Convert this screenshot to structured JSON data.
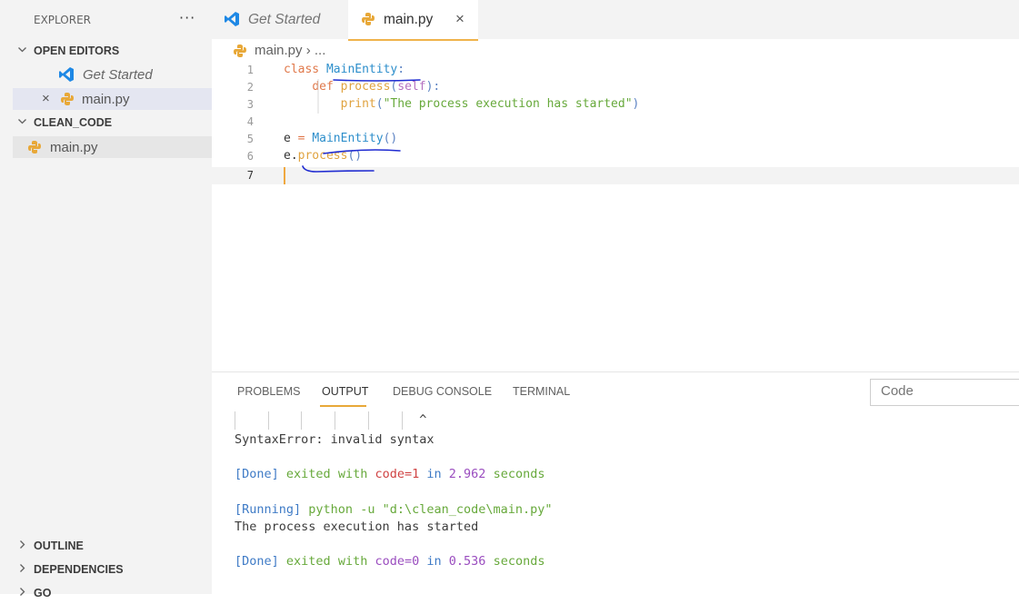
{
  "explorer": {
    "title": "EXPLORER",
    "more": "···",
    "open_editors": {
      "label": "OPEN EDITORS",
      "items": [
        {
          "label": "Get Started"
        },
        {
          "label": "main.py",
          "close": "×"
        }
      ]
    },
    "folder": {
      "label": "CLEAN_CODE",
      "items": [
        {
          "label": "main.py"
        }
      ]
    },
    "outline": "OUTLINE",
    "dependencies": "DEPENDENCIES",
    "go": "GO"
  },
  "tabs": [
    {
      "label": "Get Started"
    },
    {
      "label": "main.py",
      "close": "×"
    }
  ],
  "breadcrumb": {
    "file": "main.py",
    "sep": "›",
    "rest": "..."
  },
  "editor": {
    "line_numbers": [
      "1",
      "2",
      "3",
      "4",
      "5",
      "6",
      "7"
    ],
    "l1": {
      "kw": "class",
      "name": "MainEntity",
      "colon": ":"
    },
    "l2": {
      "indent": "    ",
      "kw": "def",
      "fn": "process",
      "open": "(",
      "param": "self",
      "close": "):"
    },
    "l3": {
      "indent": "        ",
      "fn": "print",
      "open": "(",
      "str": "\"The process execution has started\"",
      "close": ")"
    },
    "l5": {
      "var": "e",
      "eq": "=",
      "cls": "MainEntity",
      "paren": "()"
    },
    "l6": {
      "var": "e.",
      "fn": "process",
      "paren": "()"
    }
  },
  "panel": {
    "tabs": [
      "PROBLEMS",
      "OUTPUT",
      "DEBUG CONSOLE",
      "TERMINAL"
    ],
    "filter_placeholder": "Code",
    "caret_line": "                         ^",
    "error": "SyntaxError: invalid syntax",
    "done1": {
      "tag": "[Done]",
      "exited": "exited with",
      "code": "code=1",
      "in": "in",
      "time": "2.962",
      "seconds": "seconds"
    },
    "running": {
      "tag": "[Running]",
      "cmd": "python -u",
      "path": "\"d:\\clean_code\\main.py\""
    },
    "printed": "The process execution has started",
    "done2": {
      "tag": "[Done]",
      "exited": "exited with",
      "code": "code=0",
      "in": "in",
      "time": "0.536",
      "seconds": "seconds"
    }
  },
  "colors": {
    "accent_tab": "#f0b34b",
    "annotation_ink": "#1f2bd1"
  }
}
